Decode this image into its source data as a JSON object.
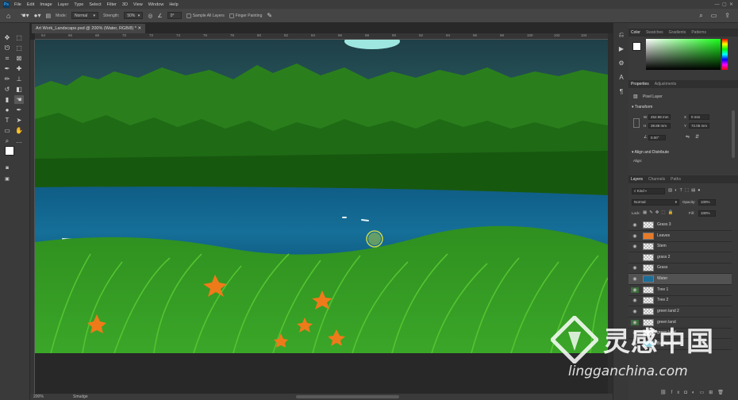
{
  "app": {
    "logo": "Ps"
  },
  "menu": [
    "File",
    "Edit",
    "Image",
    "Layer",
    "Type",
    "Select",
    "Filter",
    "3D",
    "View",
    "Window",
    "Help"
  ],
  "options": {
    "mode_label": "Mode:",
    "mode_value": "Normal",
    "strength_label": "Strength:",
    "strength_value": "50%",
    "angle_value": "0°",
    "sample_all_layers": "Sample All Layers",
    "finger_painting": "Finger Painting"
  },
  "document": {
    "tab_title": "Art Work_Landscape.psd @ 200% (Water, RGB/8) *",
    "ruler_ticks": [
      "64",
      "66",
      "68",
      "70",
      "72",
      "74",
      "76",
      "78",
      "80",
      "82",
      "84",
      "86",
      "88",
      "90",
      "92",
      "94",
      "96",
      "98",
      "100",
      "102",
      "104"
    ],
    "zoom": "200%",
    "status_tool": "Smudge"
  },
  "color_panel": {
    "tabs": [
      "Color",
      "Swatches",
      "Gradients",
      "Patterns"
    ]
  },
  "properties_panel": {
    "tabs": [
      "Properties",
      "Adjustments"
    ],
    "layer_type": "Pixel Layer",
    "transform_title": "Transform",
    "w": "452.98 mm",
    "x": "0 mm",
    "h": "39.89 mm",
    "y": "72.05 mm",
    "angle": "0.00°",
    "align_title": "Align and Distribute",
    "align_label": "Align:"
  },
  "layers_panel": {
    "tabs": [
      "Layers",
      "Channels",
      "Paths"
    ],
    "kind": "Kind",
    "blend_mode": "Normal",
    "opacity_label": "Opacity:",
    "opacity_value": "100%",
    "lock_label": "Lock:",
    "fill_label": "Fill:",
    "fill_value": "100%",
    "layers": [
      {
        "name": "Grass 3"
      },
      {
        "name": "Leaves"
      },
      {
        "name": "Stem"
      },
      {
        "name": "grass 2"
      },
      {
        "name": "Grass"
      },
      {
        "name": "Water"
      },
      {
        "name": "Tree 1"
      },
      {
        "name": "Tree 2"
      },
      {
        "name": "green land 2"
      },
      {
        "name": "green land"
      },
      {
        "name": "green land"
      },
      {
        "name": "Background"
      }
    ],
    "selected_layer": "Water"
  },
  "watermark": {
    "brand": "灵感中国",
    "url": "lingganchina.com"
  },
  "colors": {
    "foreground": "#ffffff",
    "background": "#1e4a57",
    "accent": "#31a8ff"
  }
}
